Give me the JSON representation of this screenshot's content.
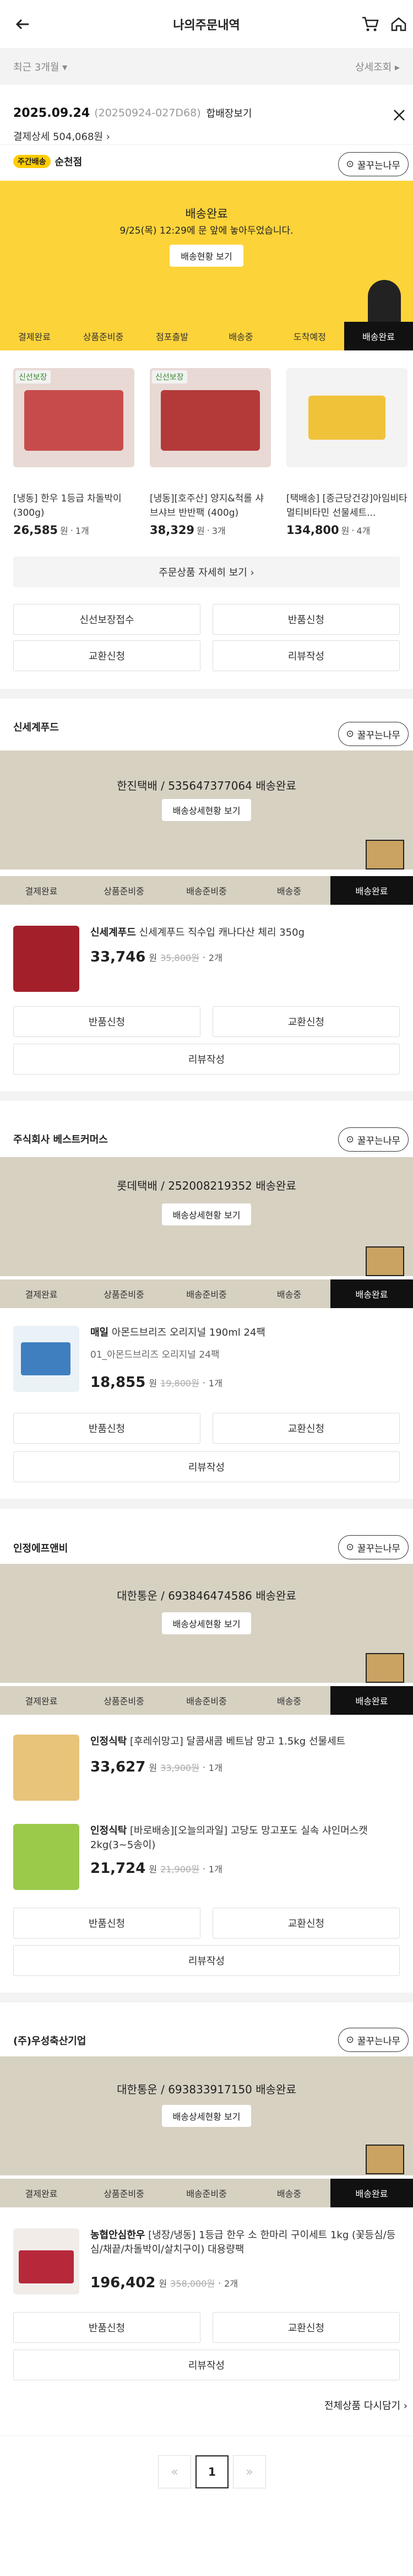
{
  "header": {
    "title": "나의주문내역"
  },
  "filter": {
    "period": "최근 3개월 ▾",
    "detail": "상세조회 ▸"
  },
  "order": {
    "date": "2025.09.24",
    "order_no": "(20250924-027D68)",
    "merge": "합배장보기",
    "pay_label": "결제상세 504,068원 ›",
    "delivery_badge": "주간배송",
    "delivery_city": "순천점"
  },
  "pill_share": "꿀꾸는나무",
  "group1": {
    "status": "배송완료",
    "note": "9/25(목) 12:29에 문 앞에 놓아두었습니다.",
    "button": "배송현황 보기",
    "steps": [
      "결제완료",
      "상품준비중",
      "점포출발",
      "배송중",
      "도착예정",
      "배송완료"
    ],
    "products": [
      {
        "tag": "신선보장",
        "name": "[냉동] 한우 1등급 차돌박이 (300g)",
        "price": "26,585",
        "unit": "원",
        "qty": "1개"
      },
      {
        "tag": "신선보장",
        "name": "[냉동][호주산] 양지&척롤 샤브샤브 반반팩 (400g)",
        "price": "38,329",
        "unit": "원",
        "qty": "3개"
      },
      {
        "tag": "",
        "name": "[택배송] [종근당건강]아임비타 멀티비타민 선물세트...",
        "price": "134,800",
        "unit": "원",
        "qty": "4개"
      }
    ],
    "detail_btn": "주문상품 자세히 보기 ›",
    "buttons": [
      "신선보장접수",
      "반품신청",
      "교환신청",
      "리뷰작성"
    ]
  },
  "group2": {
    "seller": "신세계푸드",
    "status": "한진택배 / 535647377064 배송완료",
    "button": "배송상세현황 보기",
    "steps": [
      "결제완료",
      "상품준비중",
      "배송준비중",
      "배송중",
      "배송완료"
    ],
    "product": {
      "name_bold": "신세계푸드",
      "name": "신세계푸드 직수입 캐나다산 체리 350g",
      "price": "33,746",
      "unit": "원",
      "old": "35,800원",
      "qty": "2개"
    },
    "buttons": [
      "반품신청",
      "교환신청",
      "리뷰작성"
    ]
  },
  "group3": {
    "seller": "주식회사 베스트커머스",
    "status": "롯데택배 / 252008219352 배송완료",
    "button": "배송상세현황 보기",
    "steps": [
      "결제완료",
      "상품준비중",
      "배송준비중",
      "배송중",
      "배송완료"
    ],
    "product": {
      "name_bold": "매일",
      "name": "아몬드브리즈 오리지널 190ml 24팩",
      "option": "01_아몬드브리즈 오리지널 24팩",
      "price": "18,855",
      "unit": "원",
      "old": "19,800원",
      "qty": "1개"
    },
    "buttons": [
      "반품신청",
      "교환신청",
      "리뷰작성"
    ]
  },
  "group4": {
    "seller": "인정에프앤비",
    "status": "대한통운 / 693846474586 배송완료",
    "button": "배송상세현황 보기",
    "steps": [
      "결제완료",
      "상품준비중",
      "배송준비중",
      "배송중",
      "배송완료"
    ],
    "products": [
      {
        "name_bold": "인정식탁",
        "name": "[후레쉬망고] 달콤새콤 베트남 망고 1.5kg 선물세트",
        "price": "33,627",
        "unit": "원",
        "old": "33,900원",
        "qty": "1개"
      },
      {
        "name_bold": "인정식탁",
        "name": "[바로배송][오늘의과일] 고당도 망고포도 실속 샤인머스캣 2kg(3~5송이)",
        "price": "21,724",
        "unit": "원",
        "old": "21,900원",
        "qty": "1개"
      }
    ],
    "buttons": [
      "반품신청",
      "교환신청",
      "리뷰작성"
    ]
  },
  "group5": {
    "seller": "(주)우성축산기업",
    "status": "대한통운 / 693833917150 배송완료",
    "button": "배송상세현황 보기",
    "steps": [
      "결제완료",
      "상품준비중",
      "배송준비중",
      "배송중",
      "배송완료"
    ],
    "product": {
      "name_bold": "농협안심한우",
      "name": "[냉장/냉동] 1등급 한우 소 한마리 구이세트 1kg (꽃등심/등심/채끝/차돌박이/살치구이) 대용량팩",
      "price": "196,402",
      "unit": "원",
      "old": "358,000원",
      "qty": "2개"
    },
    "buttons": [
      "반품신청",
      "교환신청",
      "리뷰작성"
    ]
  },
  "more": "전체상품 다시담기 ›",
  "pagination": {
    "page": "1",
    "prev": "«",
    "next": "»"
  }
}
